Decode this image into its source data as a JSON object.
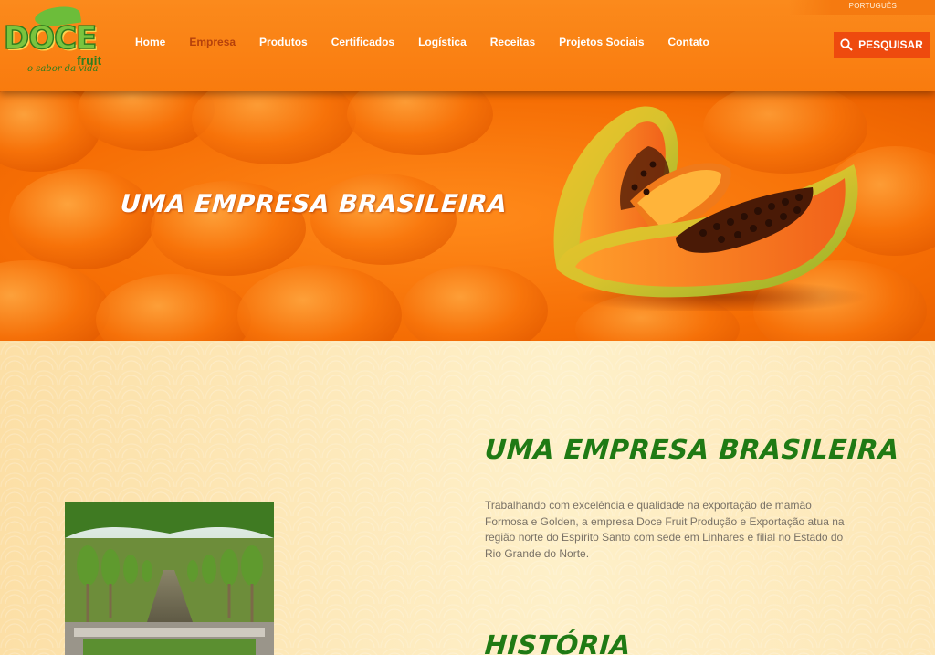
{
  "header": {
    "language": "PORTUGUÊS",
    "logo": {
      "word": "DOCE",
      "sub": "fruit",
      "tagline": "o sabor da vida"
    },
    "nav": [
      {
        "label": "Home",
        "active": false
      },
      {
        "label": "Empresa",
        "active": true
      },
      {
        "label": "Produtos",
        "active": false
      },
      {
        "label": "Certificados",
        "active": false
      },
      {
        "label": "Logística",
        "active": false
      },
      {
        "label": "Receitas",
        "active": false
      },
      {
        "label": "Projetos Sociais",
        "active": false
      },
      {
        "label": "Contato",
        "active": false
      }
    ],
    "search_label": "PESQUISAR",
    "colors": {
      "bar": "#f97b0e",
      "active": "#b5410b",
      "search": "#ee4a0e"
    }
  },
  "hero": {
    "title": "UMA EMPRESA BRASILEIRA",
    "image": "papaya-half-icon"
  },
  "main": {
    "section1_title": "UMA EMPRESA BRASILEIRA",
    "section1_text": "Trabalhando com excelência e qualidade na exportação de mamão Formosa e Golden, a empresa Doce Fruit Produção e Exportação atua na região norte do Espírito Santo com sede em Linhares e filial no Estado do Rio Grande do Norte.",
    "section2_title": "HISTÓRIA",
    "image": "papaya-plantation-photo",
    "colors": {
      "title": "#1f7a14",
      "text": "#7a7266"
    }
  }
}
